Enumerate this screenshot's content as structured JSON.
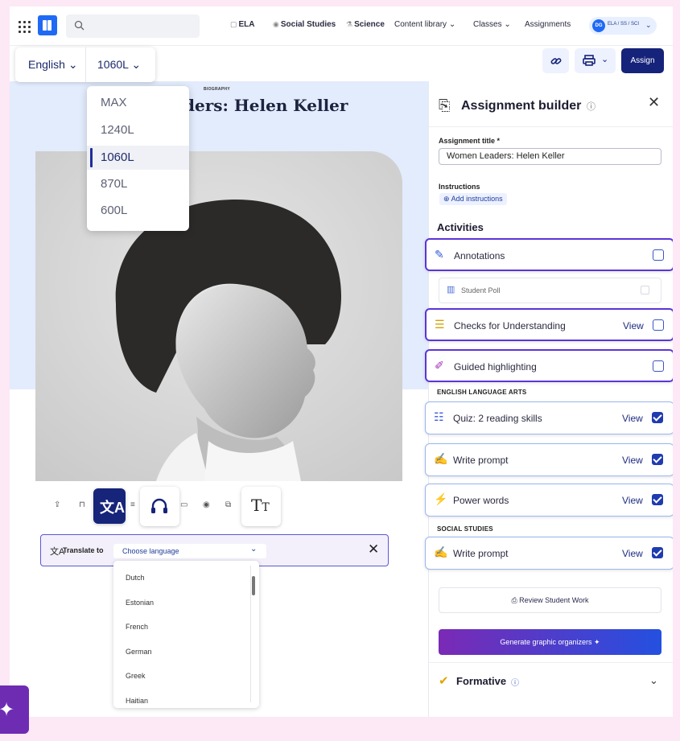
{
  "topbar": {
    "search_placeholder": "",
    "nav": [
      {
        "icon": "ela-icon",
        "label": "ELA",
        "bold": true
      },
      {
        "icon": "social-studies-icon",
        "label": "Social Studies",
        "bold": true
      },
      {
        "icon": "science-icon",
        "label": "Science",
        "bold": true
      },
      {
        "label": "Content library"
      },
      {
        "label": "Classes"
      },
      {
        "label": "Assignments"
      }
    ],
    "user_initials": "DG",
    "user_subjects": "ELA / SS / SCI"
  },
  "reader_controls": {
    "language": "English",
    "level": "1060L",
    "assign_label": "Assign"
  },
  "level_menu": {
    "options": [
      "MAX",
      "1240L",
      "1060L",
      "870L",
      "600L"
    ],
    "selected": "1060L"
  },
  "article": {
    "kicker": "BIOGRAPHY",
    "title_visible": "ders: Helen Keller"
  },
  "translate": {
    "label": "Translate to",
    "placeholder": "Choose language",
    "languages": [
      "Dutch",
      "Estonian",
      "French",
      "German",
      "Greek",
      "Haitian"
    ]
  },
  "panel": {
    "title": "Assignment builder",
    "assignment_title_label": "Assignment title *",
    "assignment_title_value": "Women Leaders: Helen Keller",
    "instructions_label": "Instructions",
    "add_instructions": "Add instructions",
    "activities_heading": "Activities",
    "activities": [
      {
        "label": "Annotations",
        "view": "",
        "checked": false
      },
      {
        "label": "Checks for Understanding",
        "view": "View",
        "checked": false
      },
      {
        "label": "Guided highlighting",
        "view": "",
        "checked": false
      }
    ],
    "poll_label": "Student Poll",
    "ela_heading": "ENGLISH LANGUAGE ARTS",
    "ela_activities": [
      {
        "label": "Quiz: 2 reading skills",
        "view": "View",
        "checked": true
      },
      {
        "label": "Write prompt",
        "view": "View",
        "checked": true
      },
      {
        "label": "Power words",
        "view": "View",
        "checked": true
      }
    ],
    "ss_heading": "SOCIAL STUDIES",
    "ss_activities": [
      {
        "label": "Write prompt",
        "view": "View",
        "checked": true
      }
    ],
    "review_label": "Review Student Work",
    "generate_label": "Generate graphic organizers",
    "formative_label": "Formative"
  },
  "colors": {
    "brand_blue": "#1f6af5",
    "navy": "#15237a",
    "purple_highlight": "#5a35d8",
    "page_background": "#fde8f6"
  }
}
